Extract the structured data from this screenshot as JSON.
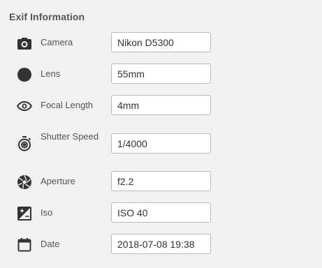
{
  "section": {
    "title": "Exif Information"
  },
  "rows": [
    {
      "key": "camera",
      "label": "Camera",
      "value": "Nikon D5300",
      "icon": "camera-icon"
    },
    {
      "key": "lens",
      "label": "Lens",
      "value": "55mm",
      "icon": "lens-icon"
    },
    {
      "key": "focal_length",
      "label": "Focal Length",
      "value": "4mm",
      "icon": "eye-icon"
    },
    {
      "key": "shutter_speed",
      "label": "Shutter Speed",
      "value": "1/4000",
      "icon": "timer-icon"
    },
    {
      "key": "aperture",
      "label": "Aperture",
      "value": "f2.2",
      "icon": "aperture-icon"
    },
    {
      "key": "iso",
      "label": "Iso",
      "value": "ISO 40",
      "icon": "exposure-icon"
    },
    {
      "key": "date",
      "label": "Date",
      "value": "2018-07-08 19:38",
      "icon": "calendar-icon"
    }
  ],
  "colors": {
    "background": "#f1f1f1",
    "icon": "#333333",
    "field_border": "#b9b9b9"
  }
}
